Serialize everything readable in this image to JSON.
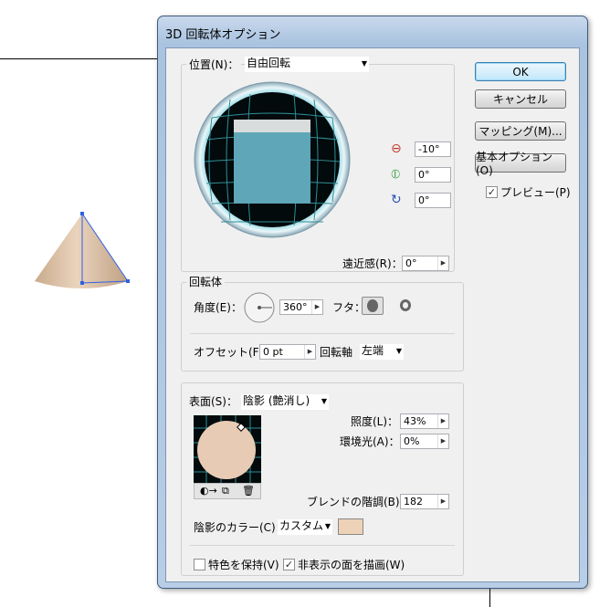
{
  "dialog": {
    "title": "3D 回転体オプション",
    "buttons": {
      "ok": "OK",
      "cancel": "キャンセル",
      "mapping": "マッピング(M)...",
      "basic_options": "基本オプション(O)"
    },
    "preview": {
      "label": "プレビュー(P)",
      "checked": true
    }
  },
  "position": {
    "label": "位置(N)：",
    "preset": "自由回転",
    "rotation_x": "-10°",
    "rotation_y": "0°",
    "rotation_z": "0°",
    "perspective_label": "遠近感(R)：",
    "perspective": "0°"
  },
  "revolve": {
    "group_label": "回転体",
    "angle_label": "角度(E)：",
    "angle": "360°",
    "cap_label": "フタ：",
    "offset_label": "オフセット(F)：",
    "offset": "0 pt",
    "axis_label": "回転軸",
    "axis": "左端"
  },
  "surface": {
    "label": "表面(S)：",
    "type": "陰影 (艶消し)",
    "intensity_label": "照度(L)：",
    "intensity": "43%",
    "ambient_label": "環境光(A)：",
    "ambient": "0%",
    "blend_steps_label": "ブレンドの階調(B)：",
    "blend_steps": "182",
    "shade_color_label": "陰影のカラー(C)：",
    "shade_color": "カスタム",
    "shade_swatch": "#eed2b8",
    "preserve_spot_label": "特色を保持(V)",
    "preserve_spot_checked": false,
    "draw_hidden_label": "非表示の面を描画(W)",
    "draw_hidden_checked": true
  },
  "colors": {
    "cube_face": "#5ea6b8",
    "sphere": "#e8cbb4",
    "cone": "#d9bfa3",
    "accent": "#3c7fb1"
  }
}
